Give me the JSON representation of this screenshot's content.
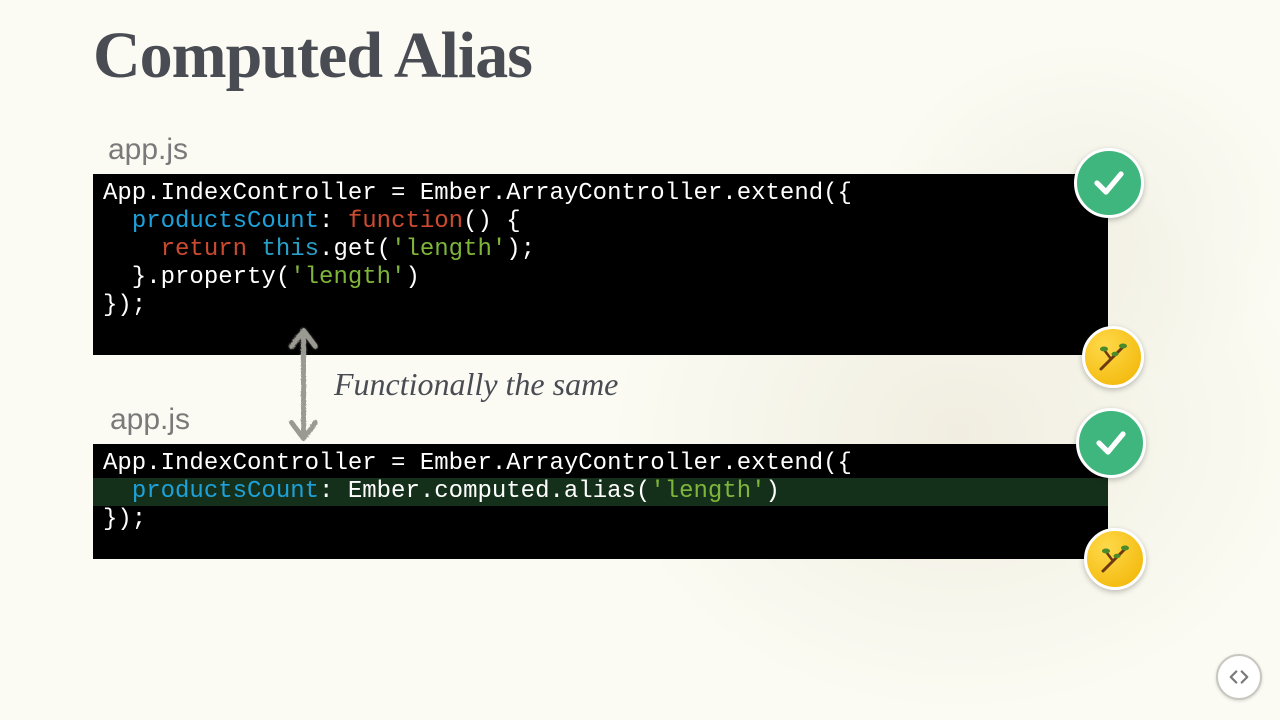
{
  "title": "Computed Alias",
  "block1": {
    "filename": "app.js",
    "code": {
      "line1_a": "App.IndexController = Ember.ArrayController.extend({",
      "line2_indent": "  ",
      "line2_key": "productsCount",
      "line2_a": ": ",
      "line2_fn": "function",
      "line2_b": "() {",
      "line3_indent": "    ",
      "line3_ret": "return",
      "line3_sp": " ",
      "line3_this": "this",
      "line3_a": ".get(",
      "line3_str": "'length'",
      "line3_b": ");",
      "line4_a": "  }.property(",
      "line4_str": "'length'",
      "line4_b": ")",
      "line5_a": "});"
    }
  },
  "annotation": "Functionally the same",
  "block2": {
    "filename": "app.js",
    "code": {
      "line1_a": "App.IndexController = Ember.ArrayController.extend({",
      "line2_indent": "  ",
      "line2_key": "productsCount",
      "line2_a": ": Ember.computed.alias(",
      "line2_str": "'length'",
      "line2_b": ")",
      "line3_a": "});"
    }
  },
  "icons": {
    "check": "check-icon",
    "branch": "branch-icon",
    "nav": "code-nav-icon"
  }
}
